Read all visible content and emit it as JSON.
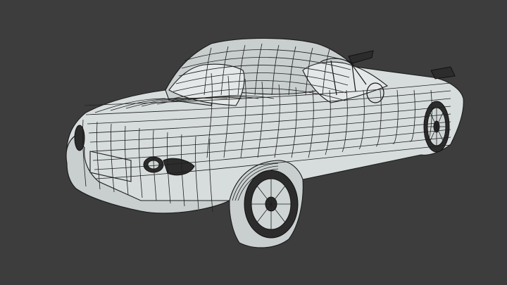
{
  "viewport": {
    "background": "#3d3d3d",
    "mesh_color": "#d7dcdc",
    "wire_color": "#1e1e1e"
  },
  "model": {
    "subject": "car-wireframe"
  }
}
